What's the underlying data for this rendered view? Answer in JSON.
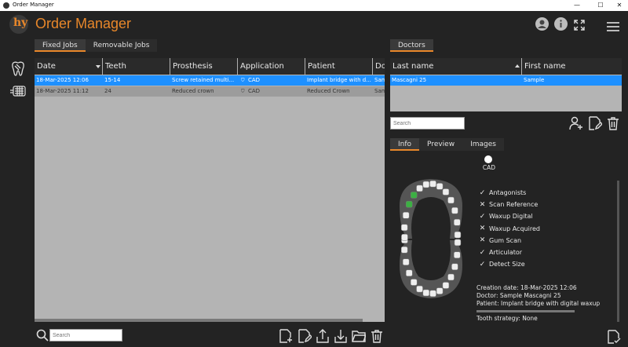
{
  "window": {
    "title": "Order Manager",
    "minimize": "—",
    "maximize": "☐",
    "close": "✕"
  },
  "app": {
    "title": "Order Manager",
    "logo_text": "hy"
  },
  "job_tabs": [
    {
      "label": "Fixed Jobs",
      "active": true
    },
    {
      "label": "Removable Jobs",
      "active": false
    }
  ],
  "jobs_table": {
    "columns": [
      "Date",
      "Teeth",
      "Prosthesis",
      "Application",
      "Patient",
      "Doc"
    ],
    "sorted_column": "Date",
    "rows": [
      {
        "date": "18-Mar-2025 12:06",
        "teeth": "15-14",
        "prosthesis": "Screw retained multi...",
        "application": "CAD",
        "patient": "Implant bridge with d...",
        "doctor": "Sam",
        "selected": true
      },
      {
        "date": "18-Mar-2025 11:12",
        "teeth": "24",
        "prosthesis": "Reduced crown",
        "application": "CAD",
        "patient": "Reduced Crown",
        "doctor": "Sam",
        "selected": false
      }
    ]
  },
  "doctors_tab": {
    "label": "Doctors"
  },
  "doctors_table": {
    "columns": [
      "Last name",
      "First name"
    ],
    "rows": [
      {
        "last_name": "Mascagni 25",
        "first_name": "Sample",
        "selected": true
      }
    ]
  },
  "doctor_search": {
    "placeholder": "Search"
  },
  "job_search": {
    "placeholder": "Search"
  },
  "detail_tabs": [
    {
      "label": "Info",
      "active": true
    },
    {
      "label": "Preview",
      "active": false
    },
    {
      "label": "Images",
      "active": false
    }
  ],
  "application_indicator": {
    "label": "CAD"
  },
  "checklist": [
    {
      "label": "Antagonists",
      "checked": true
    },
    {
      "label": "Scan Reference",
      "checked": false
    },
    {
      "label": "Waxup Digital",
      "checked": true
    },
    {
      "label": "Waxup Acquired",
      "checked": false
    },
    {
      "label": "Gum Scan",
      "checked": false
    },
    {
      "label": "Articulator",
      "checked": true
    },
    {
      "label": "Detect Size",
      "checked": true
    }
  ],
  "info": {
    "creation_date": "Creation date: 18-Mar-2025 12:06",
    "doctor": "Doctor: Sample Mascagni 25",
    "patient": "Patient: Implant bridge with digital waxup",
    "tooth_strategy": "Tooth strategy: None"
  },
  "colors": {
    "accent": "#e8872a",
    "selection": "#1e90ff",
    "background": "#232323",
    "grid": "#b4b4b4"
  }
}
